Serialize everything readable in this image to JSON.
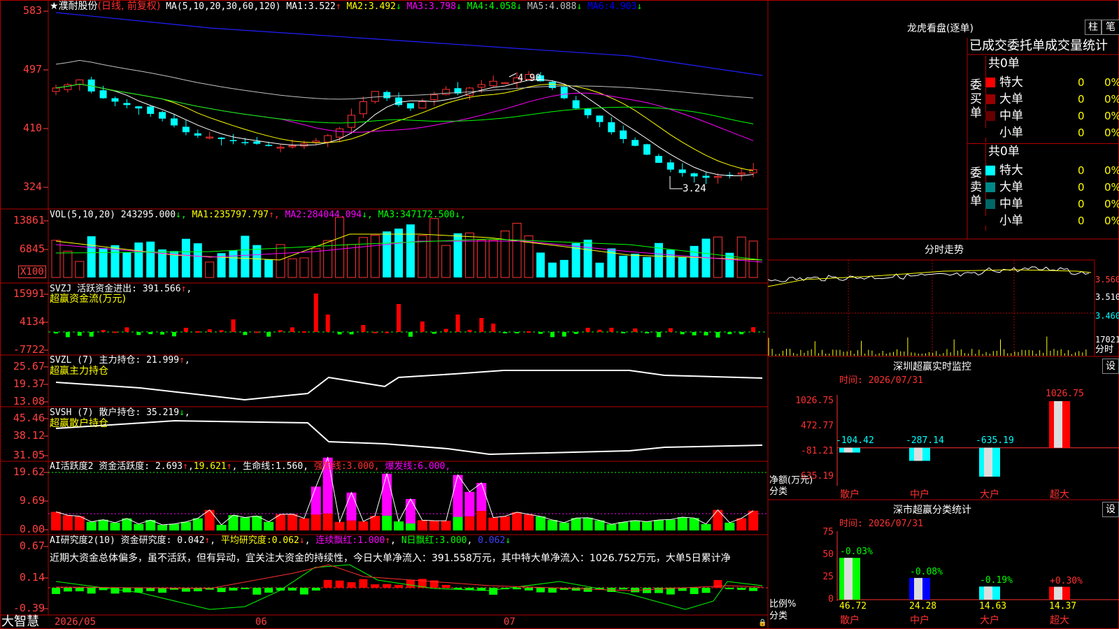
{
  "stock": {
    "name": "★濮耐股份",
    "period": "(日线, 前复权)",
    "ma_header": "MA(5,10,20,30,60,120)",
    "ma_items": [
      {
        "label": "MA1:",
        "value": "3.522",
        "arrow": "↑",
        "color": "#ffffff"
      },
      {
        "label": "MA2:",
        "value": "3.492",
        "arrow": "↓",
        "color": "#ffff00"
      },
      {
        "label": "MA3:",
        "value": "3.798",
        "arrow": "↓",
        "color": "#ff00ff"
      },
      {
        "label": "MA4:",
        "value": "4.058",
        "arrow": "↓",
        "color": "#00ff00"
      },
      {
        "label": "MA5:",
        "value": "4.088",
        "arrow": "↓",
        "color": "#c0c0c0"
      },
      {
        "label": "MA6:",
        "value": "4.903",
        "arrow": "↓",
        "color": "#0000ff"
      }
    ],
    "price_axis": [
      "583",
      "497",
      "410",
      "324"
    ],
    "high_label": "4.90",
    "low_label": "3.24"
  },
  "vol": {
    "header": "VOL(5,10,20)",
    "value": "243295.000",
    "items": [
      {
        "label": "MA1:",
        "value": "235797.797",
        "arrow": "↑",
        "color": "#ffff00"
      },
      {
        "label": "MA2:",
        "value": "284044.094",
        "arrow": "↓",
        "color": "#ff00ff"
      },
      {
        "label": "MA3:",
        "value": "347172.500",
        "arrow": "↓",
        "color": "#00ff00"
      }
    ],
    "axis": [
      "13861",
      "6845"
    ],
    "unit": "X100"
  },
  "svzj": {
    "header": "SVZJ  活跃资金进出:",
    "value": "391.566",
    "sub": "超赢资金流(万元)",
    "axis": [
      "15991",
      "4134",
      "-7722"
    ]
  },
  "svzl": {
    "header": "SVZL (7) 主力持仓:",
    "value": "21.999",
    "sub": "超赢主力持仓",
    "axis": [
      "25.67",
      "19.37",
      "13.08"
    ]
  },
  "svsh": {
    "header": "SVSH (7) 散户持仓:",
    "value": "35.219",
    "sub": "超赢散户持仓",
    "axis": [
      "45.46",
      "38.12",
      "31.05"
    ]
  },
  "ai_active": {
    "header": "AI活跃度2 资金活跃度:",
    "v1": "2.693",
    "v2": "19.621",
    "life_label": "生命线:",
    "life": "1.560",
    "strong_label": "强势线:",
    "strong": "3.000",
    "burst_label": "爆发线:",
    "burst": "6.000",
    "axis": [
      "19.62",
      "9.69",
      "0.00"
    ]
  },
  "ai_research": {
    "header": "AI研究度2(10) 资金研究度:",
    "v1": "0.042",
    "avg_label": "平均研究度:",
    "avg": "0.062",
    "cont_label": "连续飘红:",
    "cont": "1.000",
    "n_label": "N日飘红:",
    "n": "3.000",
    "n2": "0.062",
    "axis": [
      "0.67",
      "0.14",
      "-0.39"
    ],
    "analysis": "近期大资金总体偏多，虽不活跃，但有异动，宜关注大资金的持续性，今日大单净流入：391.558万元，其中特大单净流入：1026.752万元，大单5日累计净"
  },
  "x_axis": {
    "brand": "大智慧",
    "labels": [
      "2026/05",
      "06",
      "07"
    ]
  },
  "dragon": {
    "title": "龙虎看盘(逐单)",
    "btn1": "柱",
    "btn2": "笔",
    "subtitle": "已成交委托单成交量统计",
    "buy_side": "委买单",
    "sell_side": "委卖单",
    "buy_total": "共0单",
    "sell_total": "共0单",
    "buy_rows": [
      {
        "label": "特大",
        "count": "0",
        "pct": "0%",
        "color": "#ff0000"
      },
      {
        "label": "大单",
        "count": "0",
        "pct": "0%",
        "color": "#990000"
      },
      {
        "label": "中单",
        "count": "0",
        "pct": "0%",
        "color": "#660000"
      },
      {
        "label": "小单",
        "count": "0",
        "pct": "0%",
        "color": "#000000"
      }
    ],
    "sell_rows": [
      {
        "label": "特大",
        "count": "0",
        "pct": "0%",
        "color": "#00ffff"
      },
      {
        "label": "大单",
        "count": "0",
        "pct": "0%",
        "color": "#008888"
      },
      {
        "label": "中单",
        "count": "0",
        "pct": "0%",
        "color": "#006666"
      },
      {
        "label": "小单",
        "count": "0",
        "pct": "0%",
        "color": "#000000"
      }
    ]
  },
  "intraday": {
    "title": "分时走势",
    "axis": [
      "3.560",
      "3.510",
      "3.460",
      "17021"
    ],
    "unit": "分时"
  },
  "monitor": {
    "title": "深圳超赢实时监控",
    "btn": "设",
    "time": "时间: 2026/07/31",
    "axis": [
      "1026.75",
      "472.77",
      "-81.21",
      "-635.19"
    ],
    "ylabel": "净额(万元)",
    "xlabel": "分类",
    "bars": [
      {
        "cat": "散户",
        "value": -104.42,
        "label": "-104.42"
      },
      {
        "cat": "中户",
        "value": -287.14,
        "label": "-287.14"
      },
      {
        "cat": "大户",
        "value": -635.19,
        "label": "-635.19"
      },
      {
        "cat": "超大",
        "value": 1026.75,
        "label": "1026.75"
      }
    ]
  },
  "stats": {
    "title": "深市超赢分类统计",
    "btn": "设",
    "time": "时间: 2026/07/31",
    "axis": [
      "75",
      "50",
      "25",
      "0"
    ],
    "ylabel": "比例%",
    "xlabel": "分类",
    "bars": [
      {
        "cat": "散户",
        "value": 46.72,
        "label": "46.72",
        "change": "-0.03%",
        "color": "#00ff00"
      },
      {
        "cat": "中户",
        "value": 24.28,
        "label": "24.28",
        "change": "-0.08%",
        "color": "#0000ff"
      },
      {
        "cat": "大户",
        "value": 14.63,
        "label": "14.63",
        "change": "-0.19%",
        "color": "#00ffff"
      },
      {
        "cat": "超大",
        "value": 14.37,
        "label": "14.37",
        "change": "+0.30%",
        "color": "#ff0000"
      }
    ]
  },
  "colors": {
    "up": "#ff3232",
    "down": "#00ffff",
    "grid": "#b00000",
    "axis": "#ff4040",
    "panel_bg": "#000000"
  }
}
